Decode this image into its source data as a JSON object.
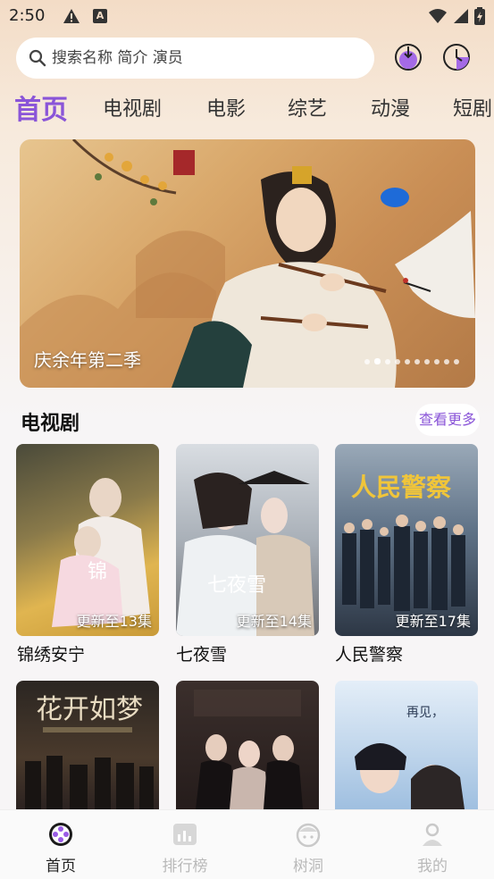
{
  "status_bar": {
    "time": "2:50"
  },
  "search": {
    "placeholder": "搜索名称 简介 演员"
  },
  "tabs": [
    {
      "label": "首页",
      "active": true
    },
    {
      "label": "电视剧"
    },
    {
      "label": "电影"
    },
    {
      "label": "综艺"
    },
    {
      "label": "动漫"
    },
    {
      "label": "短剧"
    }
  ],
  "banner": {
    "caption": "庆余年第二季",
    "slide_count": 10,
    "current_slide": 2
  },
  "section": {
    "title": "电视剧",
    "more_label": "查看更多"
  },
  "posters": [
    {
      "title": "锦绣安宁",
      "badge": "更新至13集"
    },
    {
      "title": "七夜雪",
      "badge": "更新至14集"
    },
    {
      "title": "人民警察",
      "badge": "更新至17集"
    },
    {
      "title": "",
      "badge": ""
    },
    {
      "title": "",
      "badge": ""
    },
    {
      "title": "",
      "badge": ""
    }
  ],
  "bottom_nav": [
    {
      "label": "首页",
      "icon": "film-reel-icon",
      "active": true
    },
    {
      "label": "排行榜",
      "icon": "chart-icon"
    },
    {
      "label": "树洞",
      "icon": "cloud-face-icon"
    },
    {
      "label": "我的",
      "icon": "user-icon"
    }
  ],
  "colors": {
    "accent": "#8a55d8"
  }
}
